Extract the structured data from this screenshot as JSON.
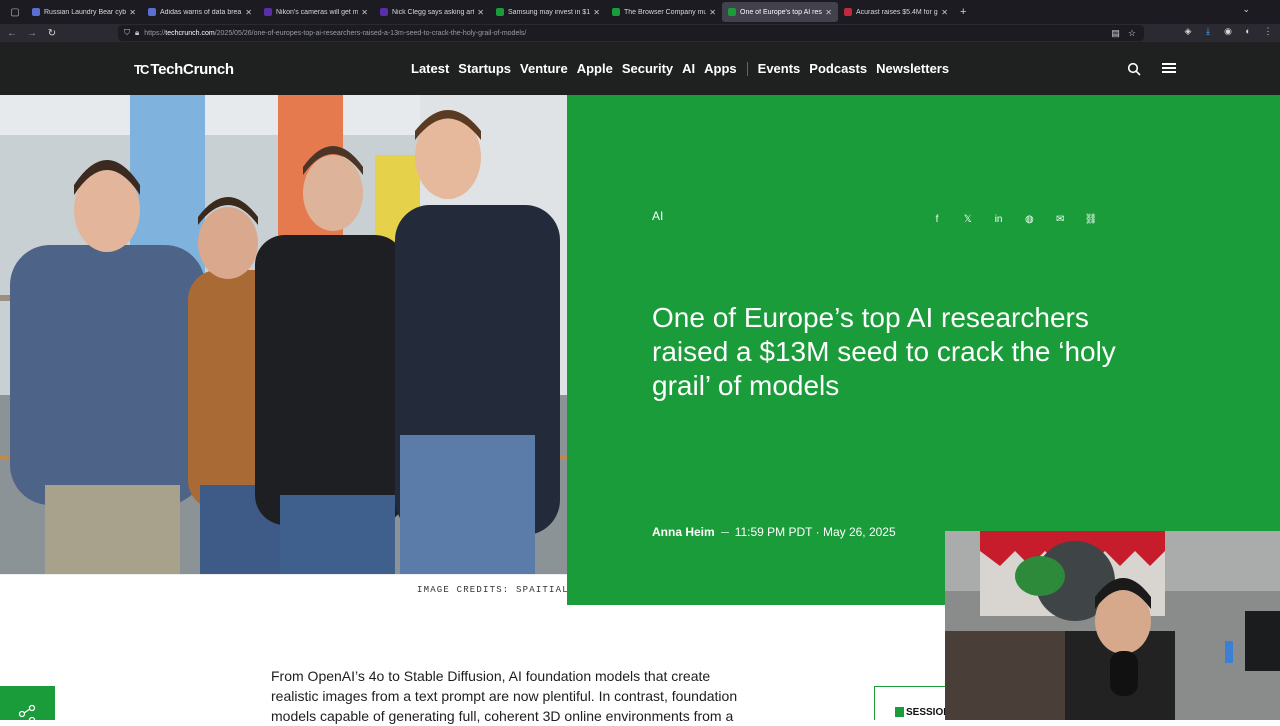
{
  "browser": {
    "tabs": [
      {
        "title": "Russian Laundry Bear cyb",
        "favicon_color": "#5b6fd0"
      },
      {
        "title": "Adidas warns of data brea",
        "favicon_color": "#5b6fd0"
      },
      {
        "title": "Nikon's cameras will get m",
        "favicon_color": "#5a2ea6"
      },
      {
        "title": "Nick Clegg says asking art",
        "favicon_color": "#5a2ea6"
      },
      {
        "title": "Samsung may invest in $1",
        "favicon_color": "#1a9c3a"
      },
      {
        "title": "The Browser Company mu",
        "favicon_color": "#1a9c3a"
      },
      {
        "title": "One of Europe's top AI res",
        "favicon_color": "#1a9c3a",
        "active": true
      },
      {
        "title": "Acurast raises $5.4M for gi",
        "favicon_color": "#c0283c"
      }
    ],
    "url_prefix": "https://",
    "url_domain": "techcrunch.com",
    "url_path": "/2025/05/26/one-of-europes-top-ai-researchers-raised-a-13m-seed-to-crack-the-holy-grail-of-models/"
  },
  "header": {
    "logo_mark": "TC",
    "logo_text": "TechCrunch",
    "nav_primary": [
      "Latest",
      "Startups",
      "Venture",
      "Apple",
      "Security",
      "AI",
      "Apps"
    ],
    "nav_secondary": [
      "Events",
      "Podcasts",
      "Newsletters"
    ]
  },
  "article": {
    "category": "AI",
    "headline": "One of Europe’s top AI researchers raised a $13M seed to crack the ‘holy grail’ of models",
    "author": "Anna Heim",
    "time": "11:59 PM PDT · May 26, 2025",
    "image_credits": "IMAGE CREDITS: SPAITIAL",
    "body_lines": [
      "From OpenAI’s 4o to Stable Diffusion, AI foundation models that create",
      "realistic images from a text prompt are now plentiful. In contrast, foundation",
      "models capable of generating full, coherent 3D online environments from a"
    ],
    "share_icons": [
      "facebook-icon",
      "x-icon",
      "linkedin-icon",
      "reddit-icon",
      "email-icon",
      "link-icon"
    ]
  },
  "ad": {
    "label": "SESSION"
  },
  "colors": {
    "brand_green": "#1a9c3a",
    "header_bg": "#1f2121"
  }
}
